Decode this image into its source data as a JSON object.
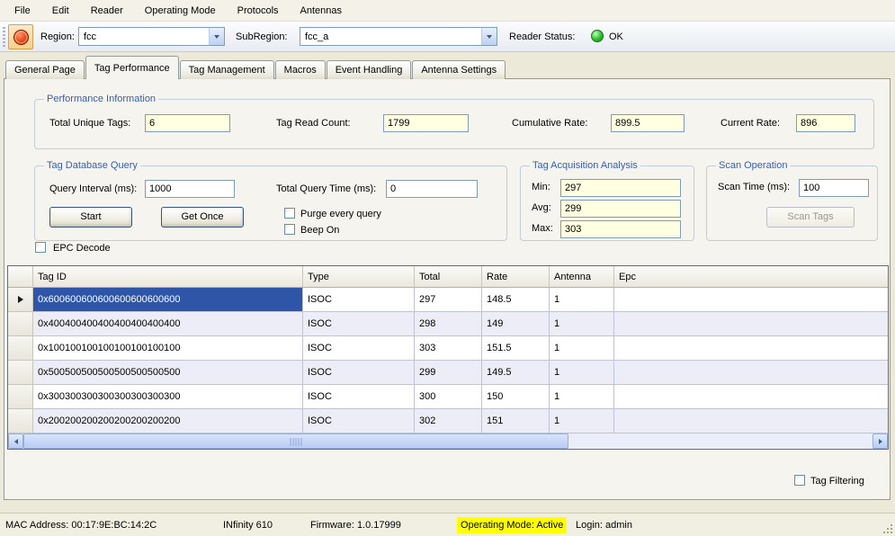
{
  "colors": {
    "selection_blue": "#2E55A8",
    "readonly_field_bg": "#FFFFE1",
    "status_ok_green": "#28C028",
    "operating_mode_highlight": "#FFFF00",
    "group_title_blue": "#3B5EA8",
    "alt_row_lavender": "#EDEDF7",
    "window_bg": "#ECE9D8"
  },
  "menu": {
    "items": [
      "File",
      "Edit",
      "Reader",
      "Operating Mode",
      "Protocols",
      "Antennas"
    ]
  },
  "toolbar": {
    "region_label": "Region:",
    "region_value": "fcc",
    "subregion_label": "SubRegion:",
    "subregion_value": "fcc_a",
    "reader_status_label": "Reader Status:",
    "reader_status_value": "OK"
  },
  "tabs": [
    {
      "label": "General Page"
    },
    {
      "label": "Tag Performance"
    },
    {
      "label": "Tag Management"
    },
    {
      "label": "Macros"
    },
    {
      "label": "Event Handling"
    },
    {
      "label": "Antenna Settings"
    }
  ],
  "performance_information": {
    "title": "Performance Information",
    "total_unique_tags_label": "Total Unique Tags:",
    "total_unique_tags_value": "6",
    "tag_read_count_label": "Tag Read Count:",
    "tag_read_count_value": "1799",
    "cumulative_rate_label": "Cumulative Rate:",
    "cumulative_rate_value": "899.5",
    "current_rate_label": "Current Rate:",
    "current_rate_value": "896"
  },
  "tag_database_query": {
    "title": "Tag Database Query",
    "query_interval_label": "Query Interval (ms):",
    "query_interval_value": "1000",
    "total_query_time_label": "Total Query Time (ms):",
    "total_query_time_value": "0",
    "start_button": "Start",
    "get_once_button": "Get Once",
    "purge_checkbox_label": "Purge every query",
    "beep_checkbox_label": "Beep On"
  },
  "tag_acquisition_analysis": {
    "title": "Tag Acquisition Analysis",
    "min_label": "Min:",
    "min_value": "297",
    "avg_label": "Avg:",
    "avg_value": "299",
    "max_label": "Max:",
    "max_value": "303"
  },
  "scan_operation": {
    "title": "Scan Operation",
    "scan_time_label": "Scan Time (ms):",
    "scan_time_value": "100",
    "scan_tags_button": "Scan Tags"
  },
  "epc_decode_label": "EPC Decode",
  "grid": {
    "columns": [
      "Tag ID",
      "Type",
      "Total",
      "Rate",
      "Antenna",
      "Epc"
    ],
    "rows": [
      {
        "tag_id": "0x600600600600600600600600",
        "type": "ISOC",
        "total": "297",
        "rate": "148.5",
        "antenna": "1",
        "epc": ""
      },
      {
        "tag_id": "0x400400400400400400400400",
        "type": "ISOC",
        "total": "298",
        "rate": "149",
        "antenna": "1",
        "epc": ""
      },
      {
        "tag_id": "0x100100100100100100100100",
        "type": "ISOC",
        "total": "303",
        "rate": "151.5",
        "antenna": "1",
        "epc": ""
      },
      {
        "tag_id": "0x500500500500500500500500",
        "type": "ISOC",
        "total": "299",
        "rate": "149.5",
        "antenna": "1",
        "epc": ""
      },
      {
        "tag_id": "0x300300300300300300300300",
        "type": "ISOC",
        "total": "300",
        "rate": "150",
        "antenna": "1",
        "epc": ""
      },
      {
        "tag_id": "0x200200200200200200200200",
        "type": "ISOC",
        "total": "302",
        "rate": "151",
        "antenna": "1",
        "epc": ""
      }
    ]
  },
  "tag_filtering_label": "Tag Filtering",
  "status_bar": {
    "mac_address": "MAC Address: 00:17:9E:BC:14:2C",
    "model": "INfinity 610",
    "firmware": "Firmware: 1.0.17999",
    "operating_mode": "Operating Mode: Active",
    "login": "Login: admin"
  }
}
